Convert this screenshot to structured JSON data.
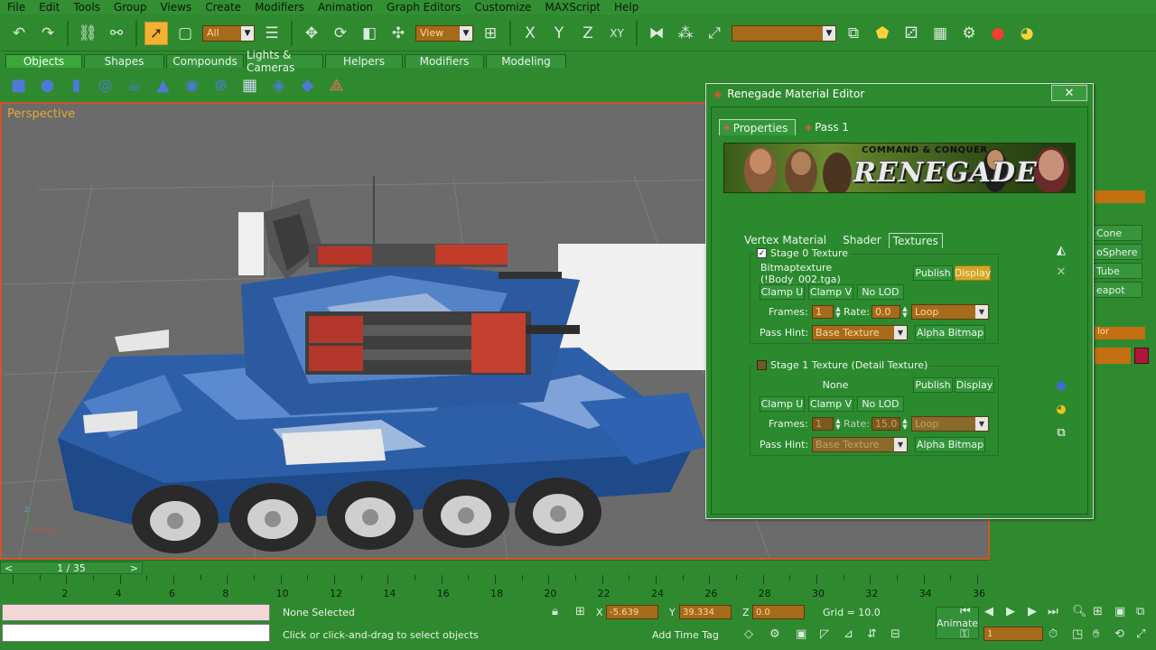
{
  "menu": [
    "File",
    "Edit",
    "Tools",
    "Group",
    "Views",
    "Create",
    "Modifiers",
    "Animation",
    "Graph Editors",
    "Customize",
    "MAXScript",
    "Help"
  ],
  "toolbar": {
    "selection_filter": "All",
    "ref_coord": "View",
    "axis_x": "X",
    "axis_y": "Y",
    "axis_z": "Z",
    "axis_xy": "XY",
    "named_selection": ""
  },
  "tabs": [
    "Objects",
    "Shapes",
    "Compounds",
    "Lights & Cameras",
    "Helpers",
    "Modifiers",
    "Modeling"
  ],
  "viewport": {
    "label": "Perspective"
  },
  "command_panel": {
    "items": [
      "Cone",
      "oSphere",
      "Tube",
      "eapot"
    ],
    "label_lor": "lor"
  },
  "dialog": {
    "title": "Renegade Material Editor",
    "close": "✕",
    "tabs": [
      "Properties",
      "Pass 1"
    ],
    "banner": {
      "command_conquer": "COMMAND & CONQUER",
      "renegade": "RENEGADE"
    },
    "subtabs": [
      "Vertex Material",
      "Shader",
      "Textures"
    ],
    "stage0": {
      "title": "Stage 0 Texture",
      "checked": true,
      "texture": "Bitmaptexture (!Body_002.tga)",
      "publish": "Publish",
      "display": "Display",
      "clamp_u": "Clamp U",
      "clamp_v": "Clamp V",
      "no_lod": "No LOD",
      "frames_label": "Frames:",
      "frames": "1",
      "rate_label": "Rate:",
      "rate": "0.0",
      "loop": "Loop",
      "pass_hint_label": "Pass Hint:",
      "pass_hint": "Base Texture",
      "alpha_bitmap": "Alpha Bitmap"
    },
    "stage1": {
      "title": "Stage 1 Texture (Detail Texture)",
      "checked": false,
      "texture": "None",
      "publish": "Publish",
      "display": "Display",
      "clamp_u": "Clamp U",
      "clamp_v": "Clamp V",
      "no_lod": "No LOD",
      "frames_label": "Frames:",
      "frames": "1",
      "rate_label": "Rate:",
      "rate": "15.0",
      "loop": "Loop",
      "pass_hint_label": "Pass Hint:",
      "pass_hint": "Base Texture",
      "alpha_bitmap": "Alpha Bitmap"
    }
  },
  "frame_slider": {
    "label": "1 / 35",
    "left": "<",
    "right": ">"
  },
  "timeline_ticks": [
    "2",
    "4",
    "6",
    "8",
    "10",
    "12",
    "14",
    "16",
    "18",
    "20",
    "22",
    "24",
    "26",
    "28",
    "30",
    "32",
    "34",
    "36"
  ],
  "status": {
    "selection": "None Selected",
    "prompt": "Click or click-and-drag to select objects",
    "x_label": "X",
    "x_value": "-5.639",
    "y_label": "Y",
    "y_value": "39.334",
    "z_label": "Z",
    "z_value": "0.0",
    "grid": "Grid = 10.0",
    "add_time_tag": "Add Time Tag",
    "animate": "Animate",
    "frame": "1"
  }
}
